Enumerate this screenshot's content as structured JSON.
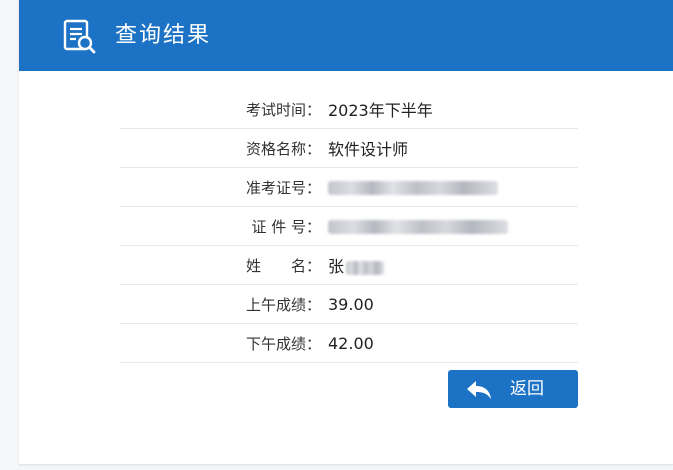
{
  "header": {
    "title": "查询结果",
    "icon": "search-document-icon",
    "color": "#1c72c4"
  },
  "rows": [
    {
      "label": "考试时间",
      "value": "2023年下半年"
    },
    {
      "label": "资格名称",
      "value": "软件设计师"
    },
    {
      "label": "准考证号",
      "value": "",
      "redacted": true
    },
    {
      "label": "证 件 号",
      "value": "",
      "redacted": true
    },
    {
      "label": "姓　　名",
      "value": "张",
      "partially_redacted": true
    },
    {
      "label": "上午成绩",
      "value": "39.00"
    },
    {
      "label": "下午成绩",
      "value": "42.00"
    }
  ],
  "colon": "：",
  "back_button": {
    "label": "返回",
    "icon": "back-arrow-icon"
  }
}
